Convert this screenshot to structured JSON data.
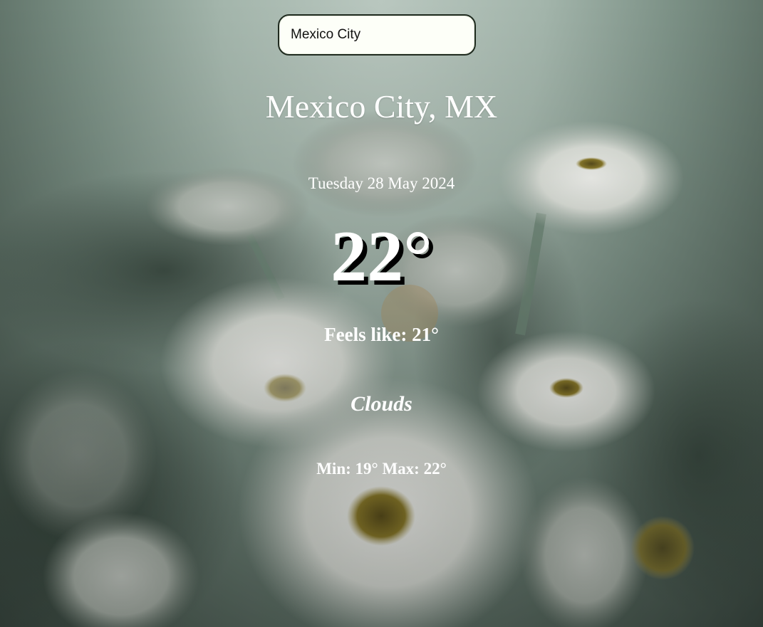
{
  "search": {
    "value": "Mexico City"
  },
  "weather": {
    "location": "Mexico City, MX",
    "date": "Tuesday 28 May 2024",
    "temperature": "22°",
    "feels_like": "Feels like: 21°",
    "condition": "Clouds",
    "min_max": "Min: 19° Max: 22°"
  },
  "background": {
    "image": "white-chrysanthemum-flowers",
    "colors": {
      "sky": "#b9c7bf",
      "foliage": "#3d4c44",
      "petal": "#e9ebe6",
      "flower-center": "#8a7a2a"
    }
  }
}
